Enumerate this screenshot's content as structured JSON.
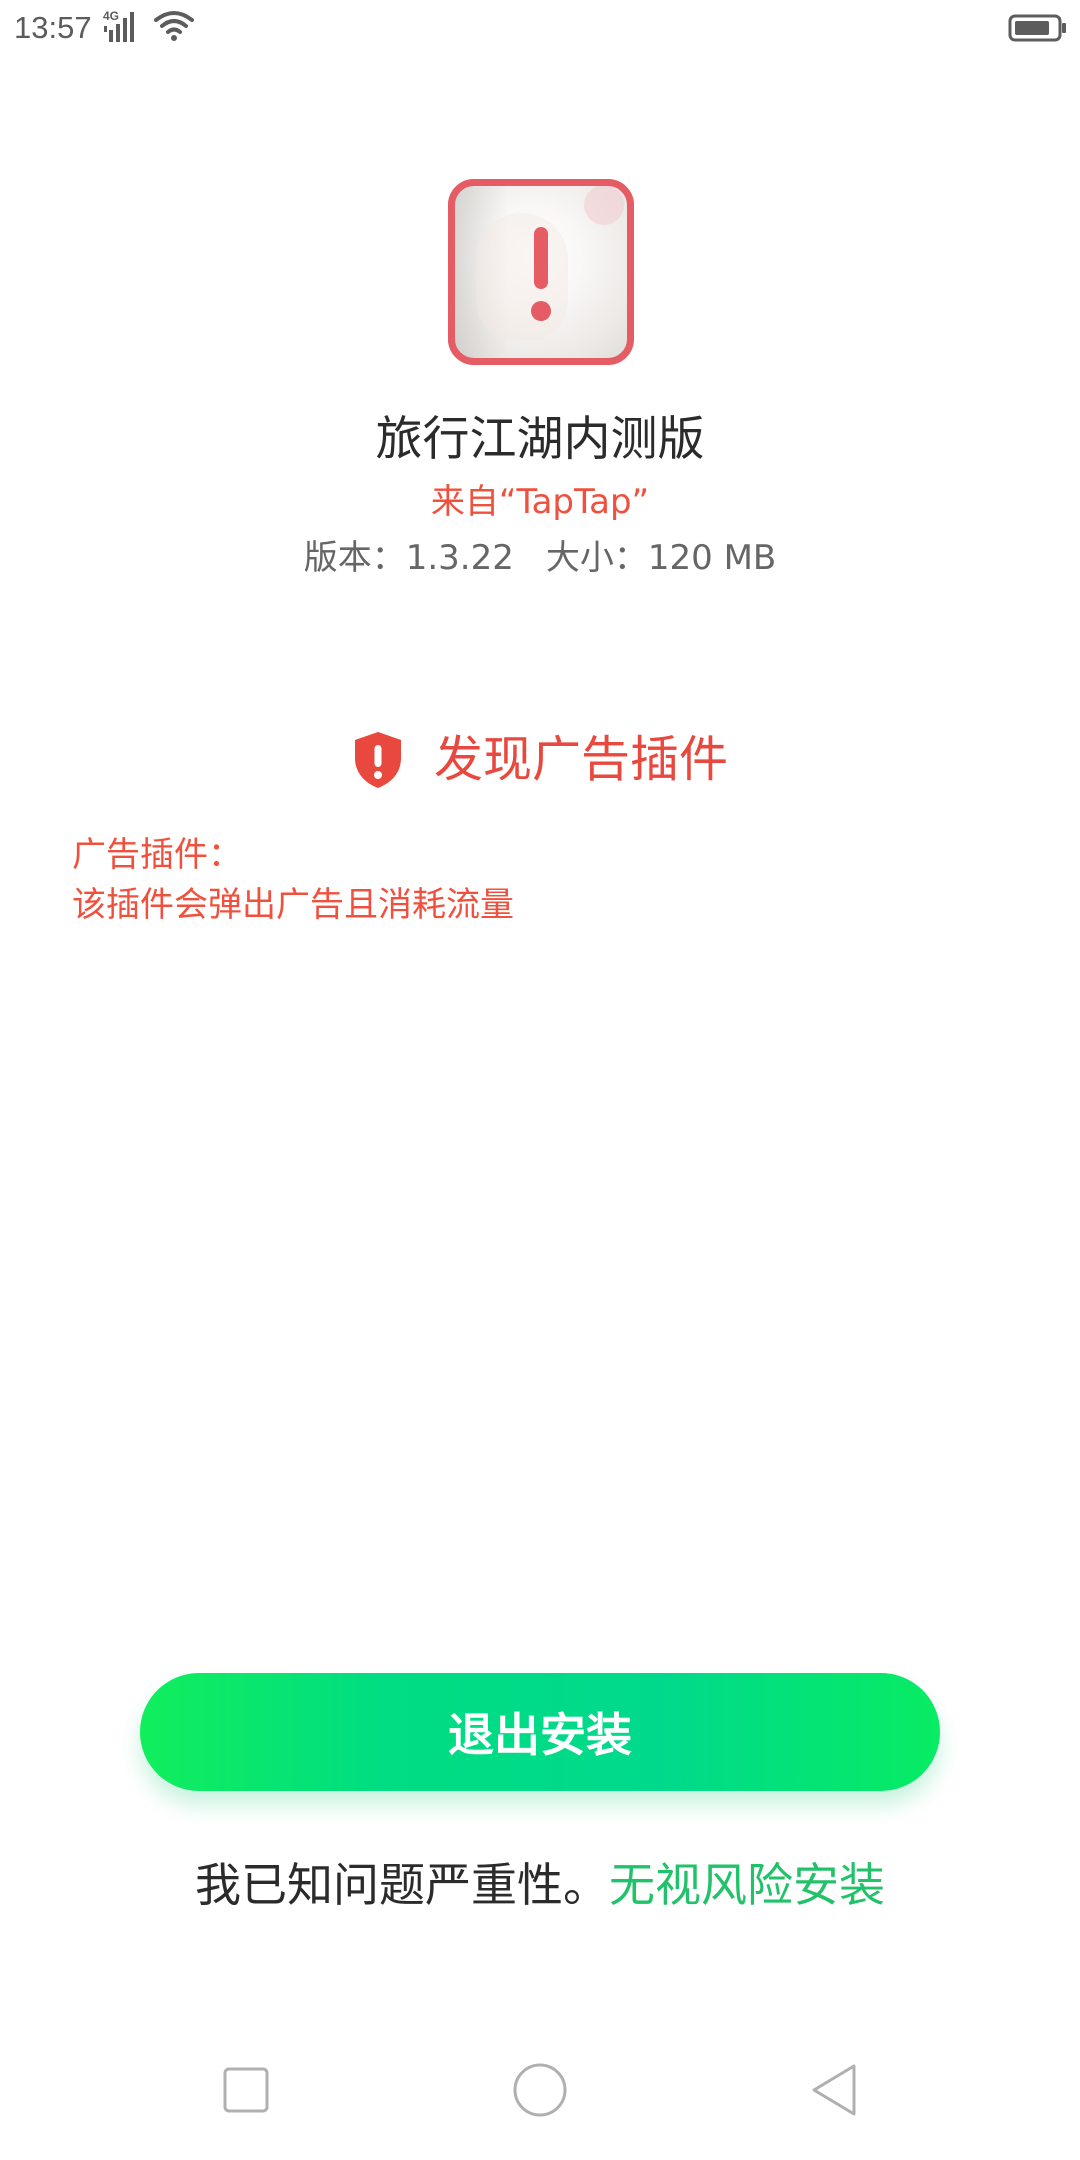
{
  "status_bar": {
    "time": "13:57",
    "network_label": "4G",
    "icons": [
      "signal-icon",
      "wifi-icon",
      "battery-icon"
    ]
  },
  "app": {
    "icon": "app-icon-with-alert-overlay",
    "name": "旅行江湖内测版",
    "source": "来自“TapTap”",
    "version_label": "版本：",
    "version": "1.3.22",
    "size_label": "大小：",
    "size": "120 MB"
  },
  "warning": {
    "icon": "shield-alert-icon",
    "title": "发现广告插件",
    "detail_title": "广告插件：",
    "detail_text": "该插件会弹出广告且消耗流量"
  },
  "actions": {
    "exit_label": "退出安装",
    "ignore_prefix": "我已知问题严重性。",
    "ignore_link": "无视风险安装"
  },
  "nav_bar": {
    "items": [
      "recents-icon",
      "home-icon",
      "back-icon"
    ]
  },
  "colors": {
    "warning_red": "#e8483e",
    "accent_green": "#22c26a",
    "button_green": "#00d98c",
    "text_dark": "#2b2b2b",
    "text_gray": "#666666"
  }
}
